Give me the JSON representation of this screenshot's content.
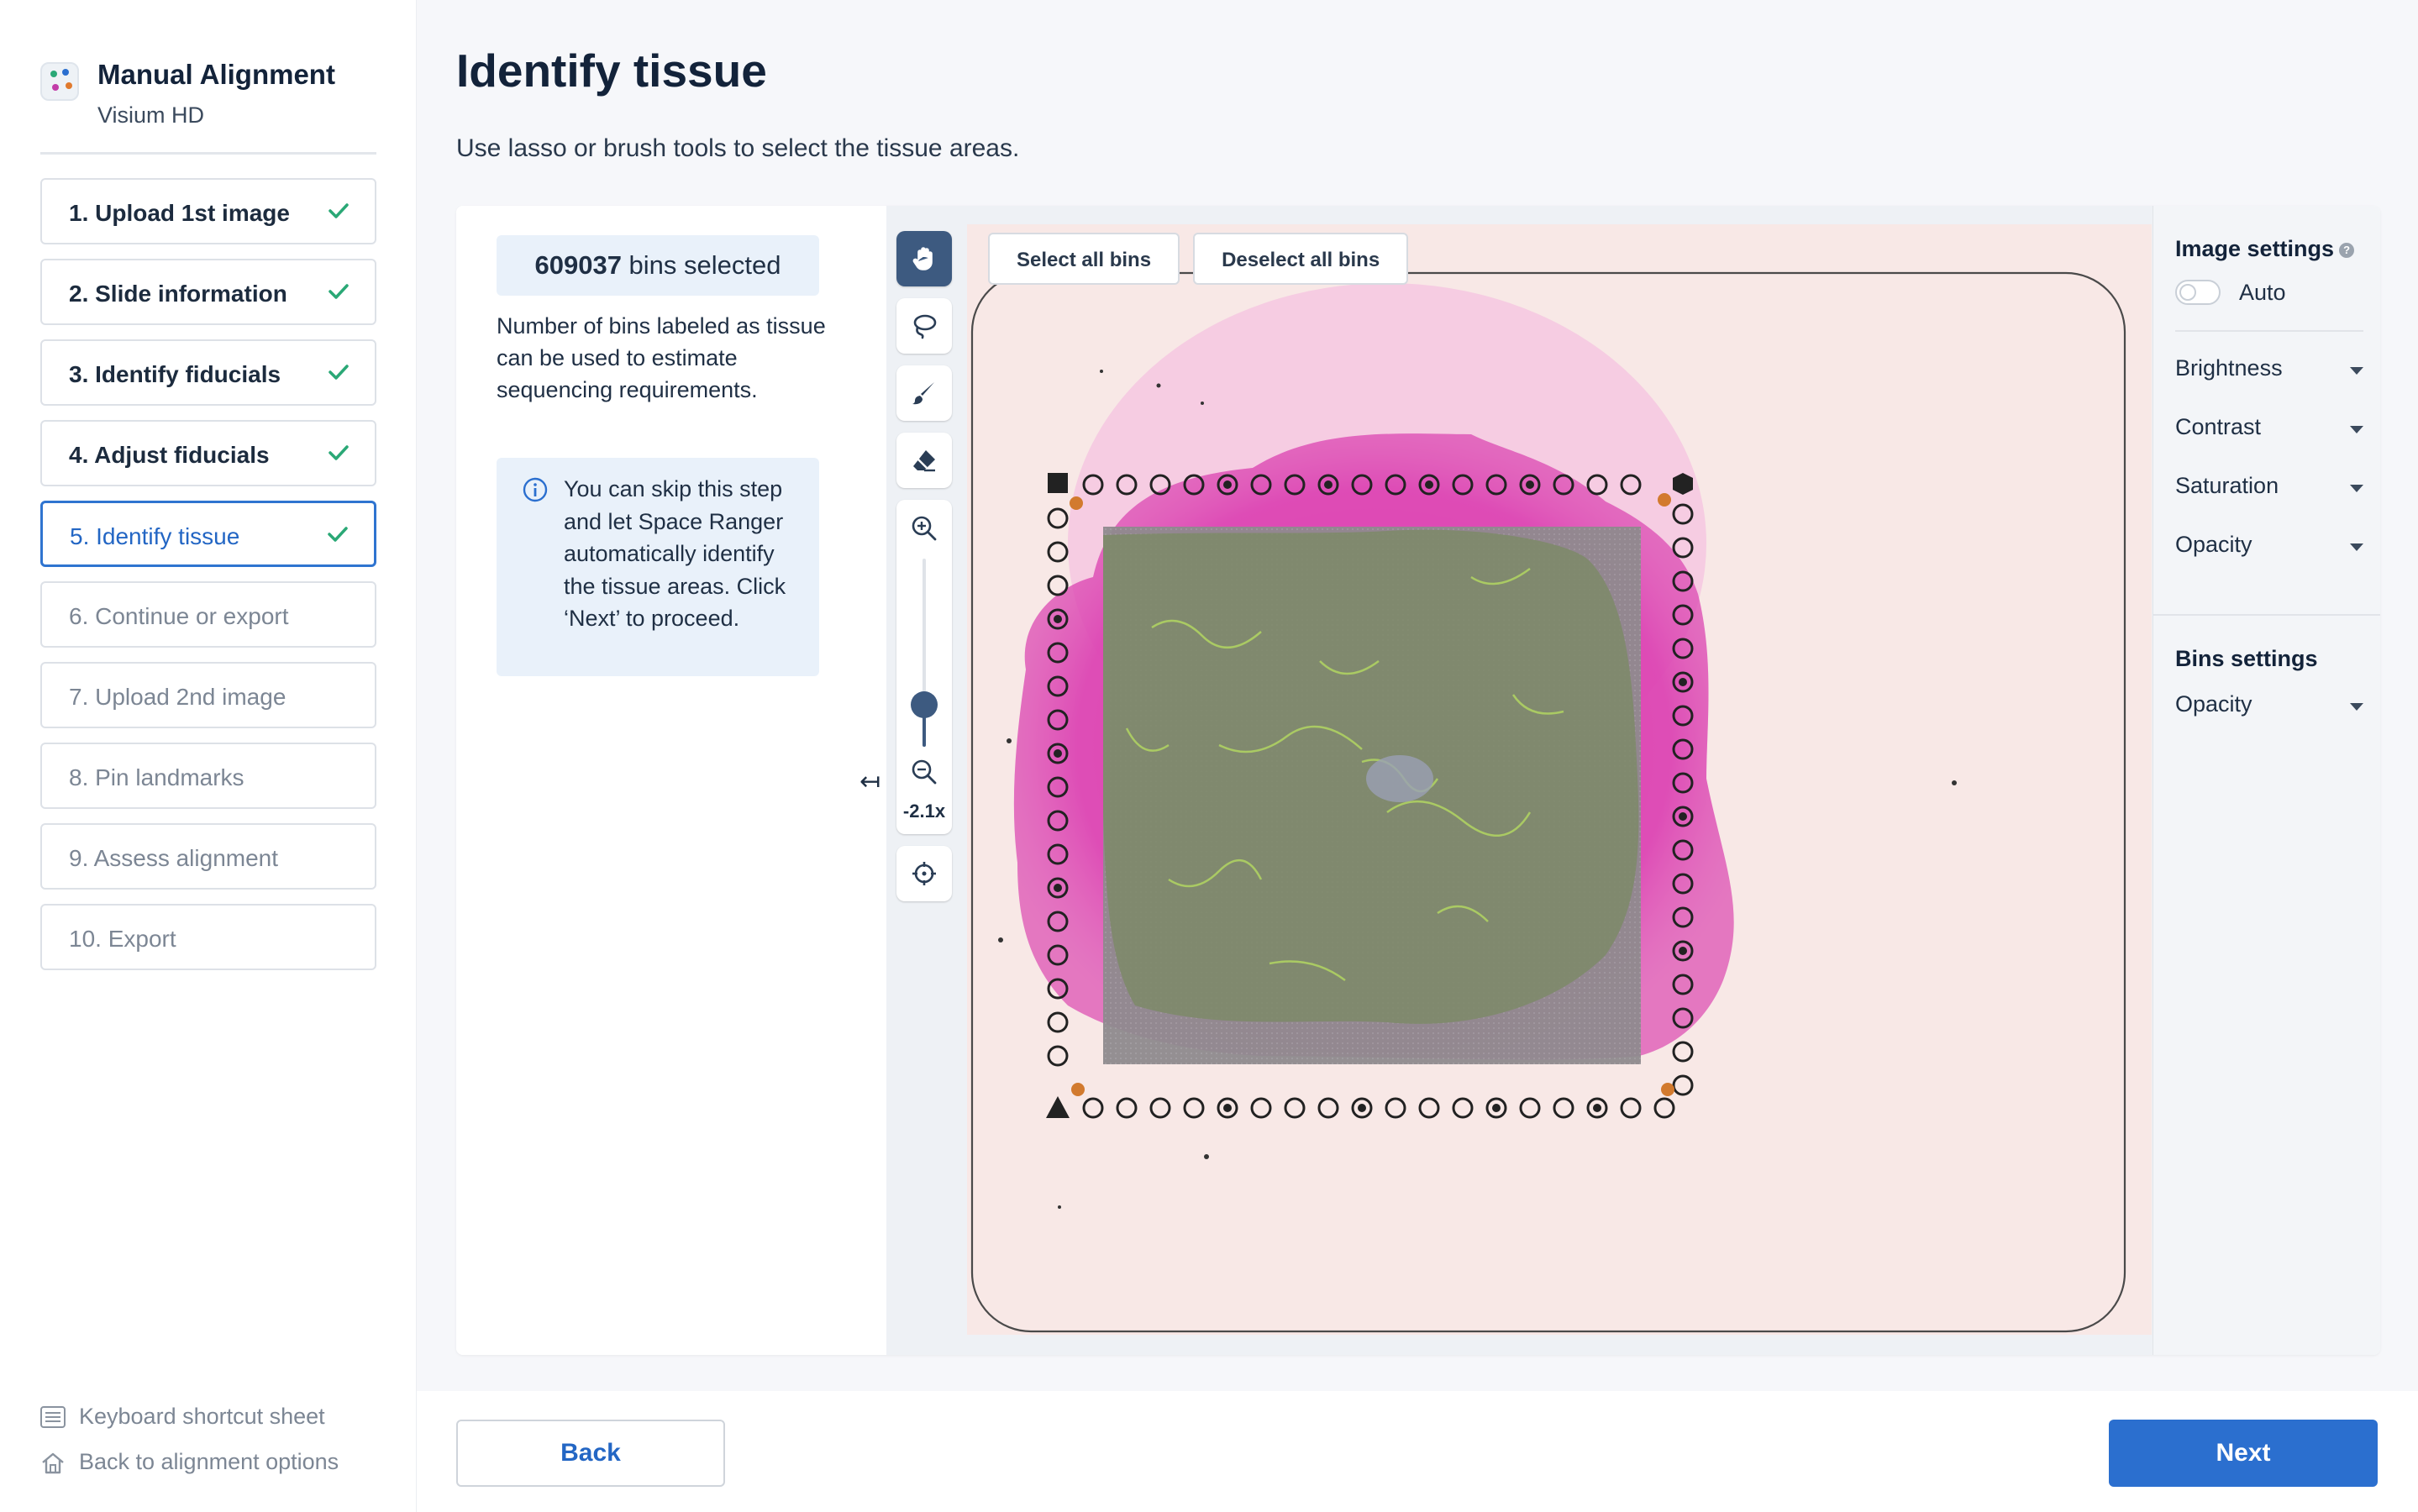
{
  "app": {
    "title": "Manual Alignment",
    "subtitle": "Visium HD"
  },
  "steps": [
    {
      "label": "1. Upload 1st image",
      "status": "complete"
    },
    {
      "label": "2. Slide information",
      "status": "complete"
    },
    {
      "label": "3. Identify fiducials",
      "status": "complete"
    },
    {
      "label": "4. Adjust fiducials",
      "status": "complete"
    },
    {
      "label": "5. Identify tissue",
      "status": "active"
    },
    {
      "label": "6. Continue or export",
      "status": "pending"
    },
    {
      "label": "7. Upload 2nd image",
      "status": "pending"
    },
    {
      "label": "8. Pin landmarks",
      "status": "pending"
    },
    {
      "label": "9. Assess alignment",
      "status": "pending"
    },
    {
      "label": "10. Export",
      "status": "pending"
    }
  ],
  "footer": {
    "shortcuts": "Keyboard shortcut sheet",
    "back_options": "Back to alignment options"
  },
  "page": {
    "title": "Identify tissue",
    "description": "Use lasso or brush tools to select the tissue areas."
  },
  "bins": {
    "count": "609037",
    "count_suffix": " bins selected",
    "note": "Number of bins labeled as tissue can be used to estimate sequencing requirements.",
    "info": "You can skip this step and let Space Ranger automatically identify the tissue areas. Click ‘Next’ to proceed."
  },
  "viewer": {
    "select_all": "Select all bins",
    "deselect_all": "Deselect all bins",
    "zoom_level": "-2.1x",
    "collapse_icon": "↤",
    "tools": [
      "hand-icon",
      "lasso-icon",
      "brush-icon",
      "eraser-icon",
      "zoom-in-icon",
      "zoom-out-icon",
      "crosshair-icon"
    ]
  },
  "settings": {
    "image_title": "Image settings",
    "auto_label": "Auto",
    "auto_enabled": false,
    "image_rows": [
      "Brightness",
      "Contrast",
      "Saturation",
      "Opacity"
    ],
    "bins_title": "Bins settings",
    "bins_rows": [
      "Opacity"
    ]
  },
  "actions": {
    "back": "Back",
    "next": "Next"
  },
  "colors": {
    "accent": "#2b6fcf",
    "complete_check": "#2aa876",
    "tissue_stain": "#e040b5",
    "selection_overlay": "#7e8a6a"
  }
}
